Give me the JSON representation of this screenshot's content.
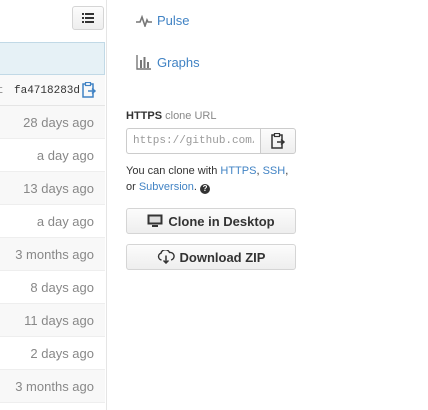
{
  "file_list": {
    "toggle_icon": "list-icon",
    "commit": {
      "sha_prefix": "t",
      "sha": "fa4718283d",
      "copy_icon": "clipboard-icon"
    },
    "ages": [
      "28 days ago",
      "a day ago",
      "13 days ago",
      "a day ago",
      "3 months ago",
      "8 days ago",
      "11 days ago",
      "2 days ago",
      "3 months ago"
    ]
  },
  "nav": {
    "pulse": {
      "label": "Pulse",
      "icon": "pulse-icon"
    },
    "graphs": {
      "label": "Graphs",
      "icon": "graph-icon"
    }
  },
  "clone": {
    "protocol": "HTTPS",
    "label_suffix": "clone URL",
    "url_value": "https://github.com/c",
    "copy_icon": "clipboard-icon",
    "help_prefix": "You can clone with",
    "https_link": "HTTPS",
    "sep1": ",",
    "ssh_link": "SSH",
    "sep2": ",",
    "or_text": "or",
    "subversion_link": "Subversion",
    "period": ".",
    "help_icon_glyph": "?"
  },
  "buttons": {
    "desktop": {
      "label": "Clone in Desktop",
      "icon": "monitor-icon"
    },
    "zip": {
      "label": "Download ZIP",
      "icon": "cloud-download-icon"
    }
  },
  "colors": {
    "link": "#4183c4",
    "commit_header_bg": "#e6f1f6",
    "muted": "#888888"
  }
}
